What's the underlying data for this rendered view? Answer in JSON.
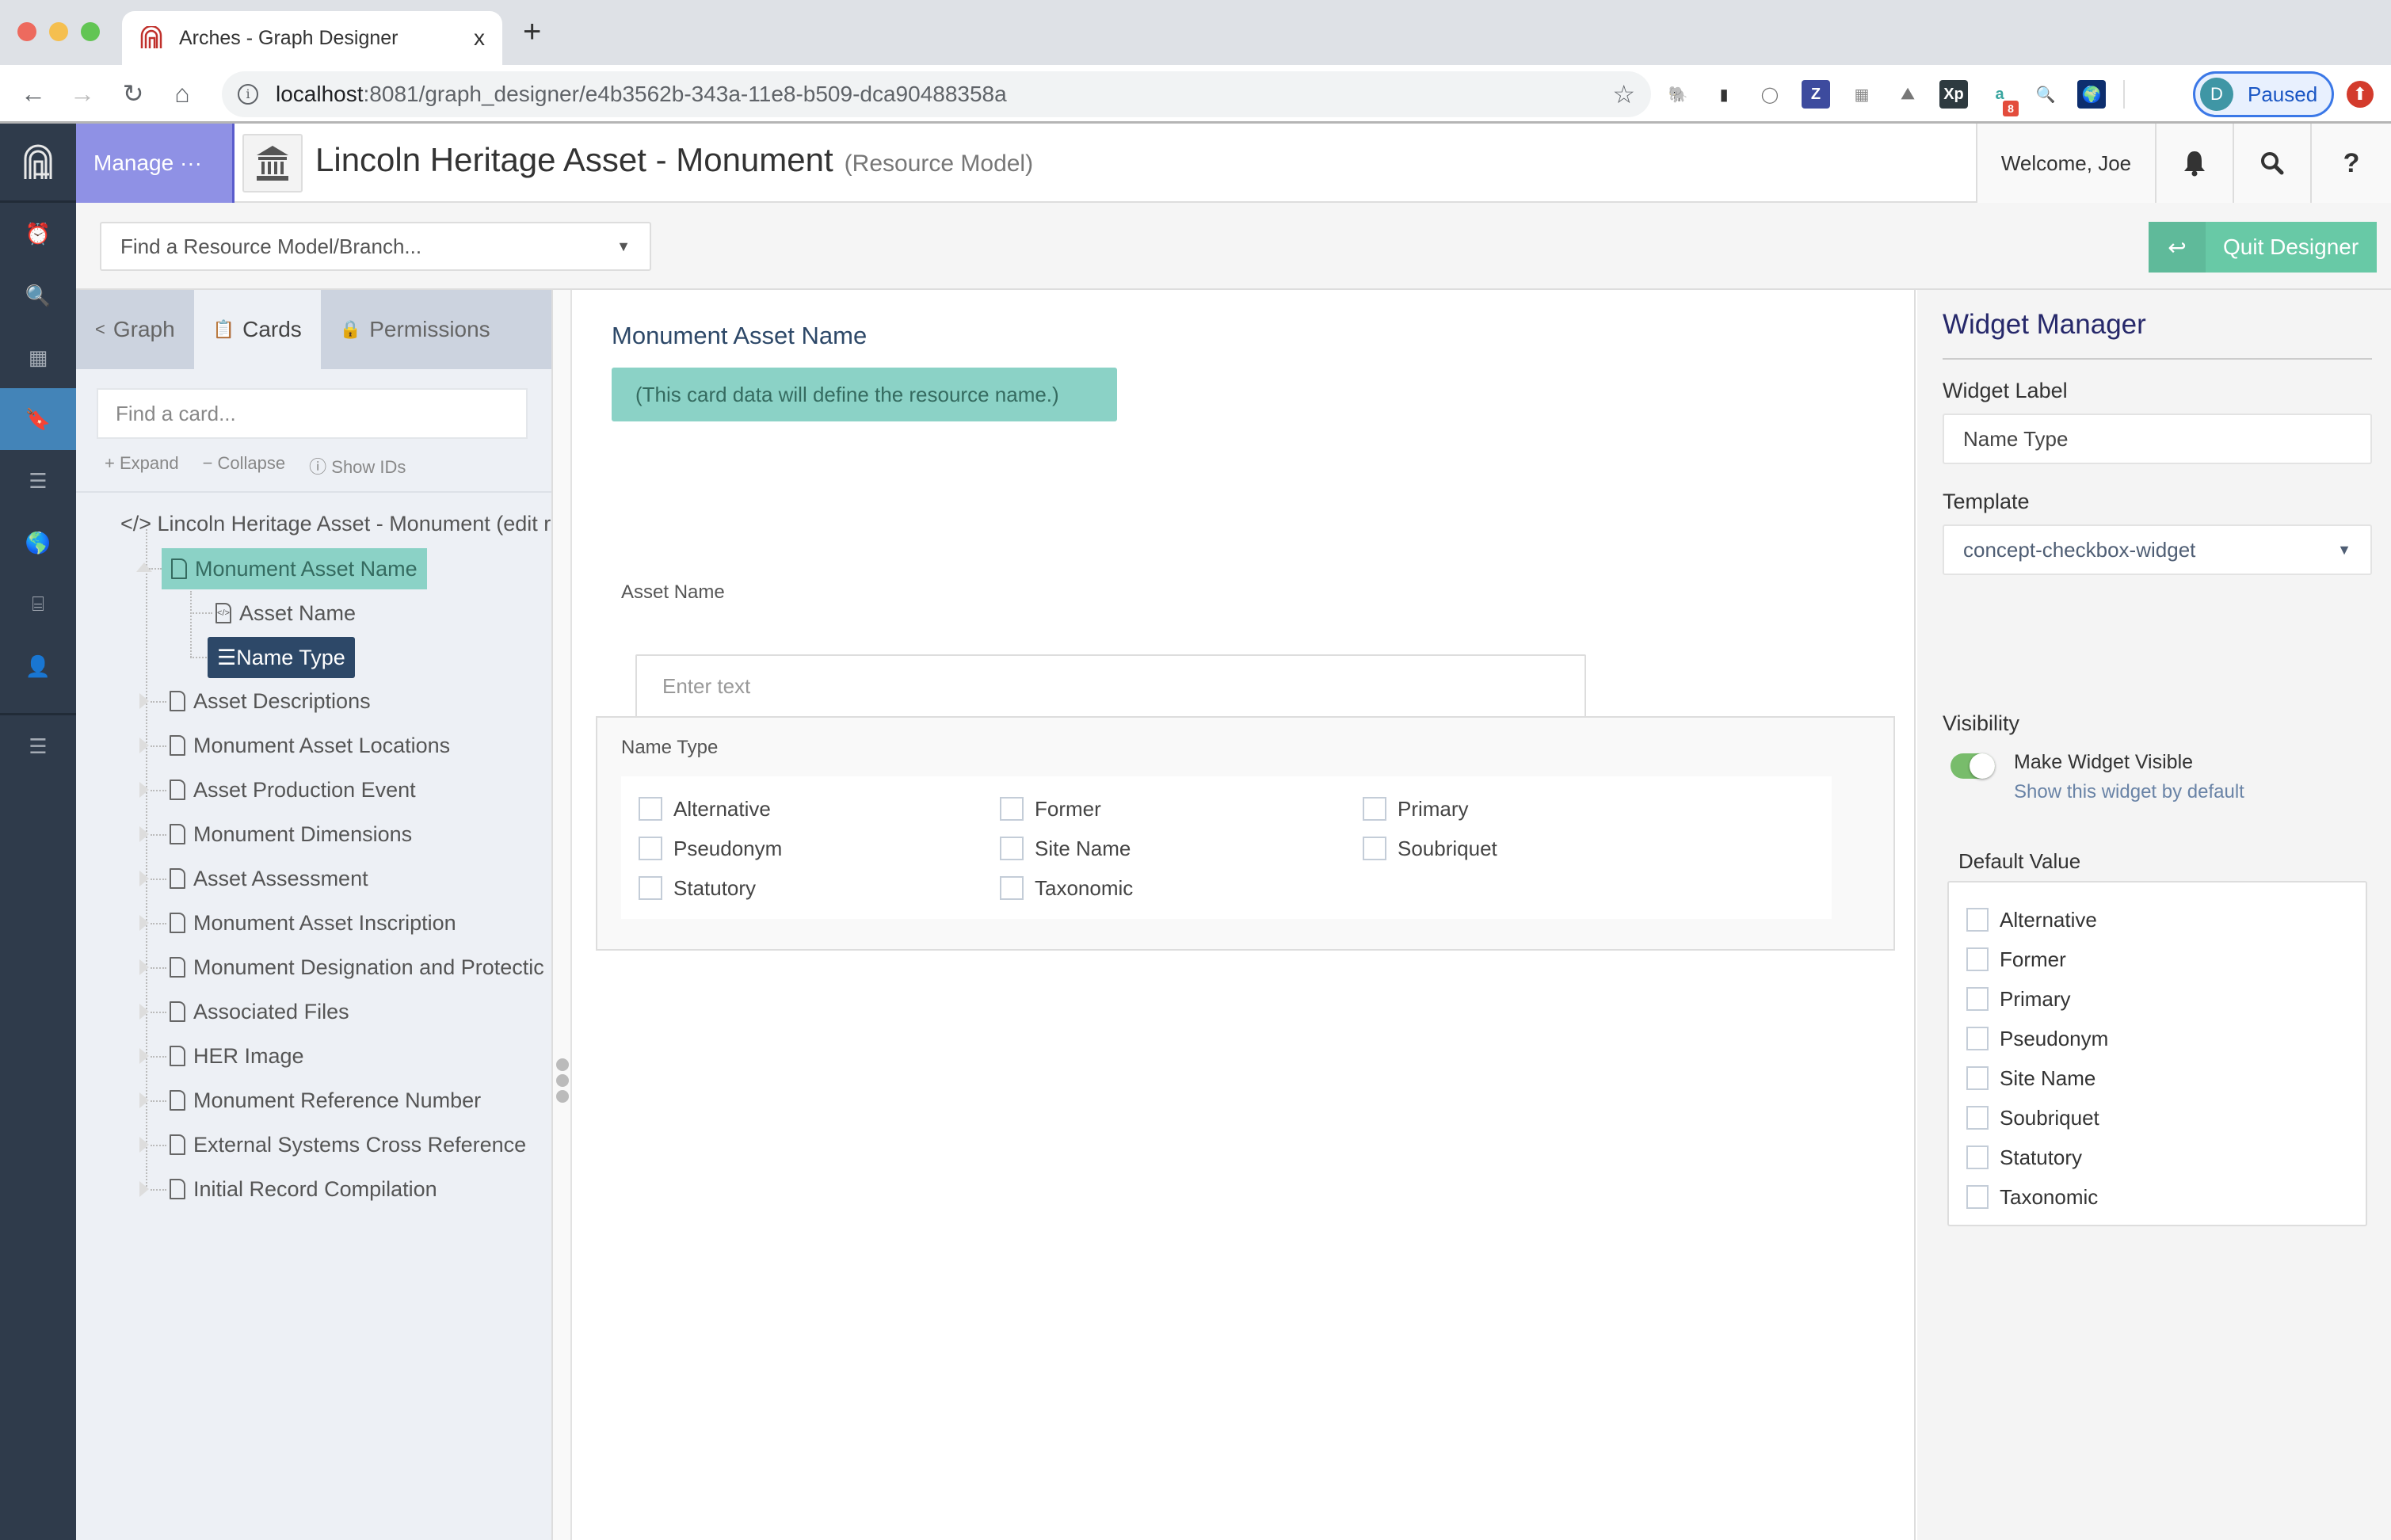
{
  "browser": {
    "tab_title": "Arches - Graph Designer",
    "tab_close": "x",
    "new_tab": "+",
    "url_host": "localhost",
    "url_path": ":8081/graph_designer/e4b3562b-343a-11e8-b509-dca90488358a",
    "extensions": [
      {
        "name": "evernote-icon",
        "glyph": "🐘",
        "bg": "#ffffff",
        "color": "#4db24a"
      },
      {
        "name": "easel-icon",
        "glyph": "▮",
        "bg": "#ffffff",
        "color": "#333333"
      },
      {
        "name": "circle-extension-icon",
        "glyph": "◯",
        "bg": "#ffffff",
        "color": "#777777"
      },
      {
        "name": "zotero-icon",
        "glyph": "Z",
        "bg": "#3d4b9e",
        "color": "#ffffff"
      },
      {
        "name": "grid-extension-icon",
        "glyph": "▦",
        "bg": "#ffffff",
        "color": "#888888"
      },
      {
        "name": "geojson-io-icon",
        "glyph": "⛰",
        "bg": "#ffffff",
        "color": "#777777"
      },
      {
        "name": "xp-icon",
        "glyph": "Xp",
        "bg": "#2e3a40",
        "color": "#ffffff"
      },
      {
        "name": "a-extension-icon",
        "glyph": "a",
        "bg": "#ffffff",
        "color": "#3aa6a0",
        "badge": "8"
      },
      {
        "name": "magnifier-extension-icon",
        "glyph": "🔍",
        "bg": "#ffffff",
        "color": "#6a8e2a"
      },
      {
        "name": "globe-extension-icon",
        "glyph": "🌍",
        "bg": "#0d2e6e",
        "color": "#ffffff"
      }
    ],
    "profile_initial": "D",
    "profile_status": "Paused"
  },
  "header": {
    "manage_label": "Manage ···",
    "title": "Lincoln Heritage Asset - Monument",
    "subtitle": "(Resource Model)",
    "welcome": "Welcome, Joe",
    "help_label": "?"
  },
  "subbar": {
    "model_select_placeholder": "Find a Resource Model/Branch...",
    "quit_label": "Quit Designer"
  },
  "leftnav": [
    {
      "name": "clock-icon",
      "glyph": "⏰",
      "active": false
    },
    {
      "name": "search-icon",
      "glyph": "🔍",
      "active": false
    },
    {
      "name": "building-icon",
      "glyph": "▦",
      "active": false
    },
    {
      "name": "bookmark-icon",
      "glyph": "🔖",
      "active": true
    },
    {
      "name": "server-icon",
      "glyph": "☰",
      "active": false
    },
    {
      "name": "globe-icon",
      "glyph": "🌎",
      "active": false
    },
    {
      "name": "ticket-icon",
      "glyph": "⌸",
      "active": false
    },
    {
      "name": "user-icon",
      "glyph": "👤",
      "active": false
    }
  ],
  "treepanel": {
    "tabs": [
      {
        "label": "Graph",
        "icon": "share-icon",
        "glyph": "<",
        "active": false
      },
      {
        "label": "Cards",
        "icon": "clipboard-icon",
        "glyph": "📋",
        "active": true
      },
      {
        "label": "Permissions",
        "icon": "lock-icon",
        "glyph": "🔒",
        "active": false
      }
    ],
    "search_placeholder": "Find a card...",
    "tools": {
      "expand": "+ Expand",
      "collapse": "− Collapse",
      "show_ids": "ⓘ Show IDs"
    },
    "root_label": "</> Lincoln Heritage Asset - Monument (edit r",
    "selected_card": "Monument Asset Name",
    "selected_card_children": [
      {
        "label": "Asset Name",
        "icon": "code-file-icon"
      },
      {
        "label": "Name Type",
        "icon": "list-icon",
        "selected": true
      }
    ],
    "cards": [
      "Asset Descriptions",
      "Monument Asset Locations",
      "Asset Production Event",
      "Monument Dimensions",
      "Asset Assessment",
      "Monument Asset Inscription",
      "Monument Designation and Protectic",
      "Associated Files",
      "HER Image",
      "Monument Reference Number",
      "External Systems Cross Reference",
      "Initial Record Compilation"
    ]
  },
  "main": {
    "card_title": "Monument Asset Name",
    "card_note": "(This card data will define the resource name.)",
    "asset_name_label": "Asset Name",
    "asset_name_placeholder": "Enter text",
    "name_type_label": "Name Type",
    "name_type_options": [
      "Alternative",
      "Former",
      "Primary",
      "Pseudonym",
      "Site Name",
      "Soubriquet",
      "Statutory",
      "Taxonomic"
    ]
  },
  "widget_manager": {
    "title": "Widget Manager",
    "label_label": "Widget Label",
    "label_value": "Name Type",
    "template_label": "Template",
    "template_value": "concept-checkbox-widget",
    "visibility_label": "Visibility",
    "visible": true,
    "toggle_label": "Make Widget Visible",
    "toggle_hint": "Show this widget by default",
    "default_value_label": "Default Value",
    "default_options": [
      "Alternative",
      "Former",
      "Primary",
      "Pseudonym",
      "Site Name",
      "Soubriquet",
      "Statutory",
      "Taxonomic"
    ]
  },
  "colors": {
    "manage_purple": "#8f91e5",
    "nav_dark": "#2f3b4b",
    "nav_active": "#4384b8",
    "teal_highlight": "#8bd2c6",
    "selected_navy": "#2d4868",
    "quit_green": "#68c9a6",
    "toggle_green": "#78bc6b"
  }
}
